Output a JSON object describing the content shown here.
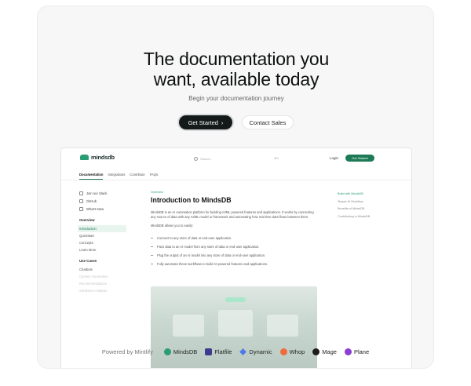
{
  "hero": {
    "title_line1": "The documentation you",
    "title_line2": "want, available today",
    "subtitle": "Begin your documentation journey",
    "primary_button": "Get Started",
    "secondary_button": "Contact Sales"
  },
  "docs": {
    "logo": "mindsdb",
    "search_placeholder": "Search...",
    "search_shortcut": "⌘K",
    "login": "Login",
    "cta": "Get Started",
    "nav_tabs": [
      "Documentation",
      "Integrations",
      "Contribute",
      "FAQs"
    ],
    "sidebar": {
      "links": [
        "Join our Slack",
        "GitHub",
        "What's New"
      ],
      "overview_heading": "Overview",
      "overview_items": [
        "Introduction",
        "Quickstart",
        "Concepts",
        "Learn More"
      ],
      "usecases_heading": "Use Cases",
      "usecases_items": [
        "Chatbots",
        "Content Generation",
        "Recommendations",
        "Sentiment Analysis"
      ]
    },
    "breadcrumb": "Overview",
    "heading": "Introduction to MindsDB",
    "para1": "MindsDB is an AI Automation platform for building AI/ML powered features and applications. It works by connecting any source of data with any AI/ML model or framework and automating how real-time data flows between them.",
    "para2": "MindsDB allows you to easily:",
    "bullets": [
      "Connect to any store of data or end-user application.",
      "Pass data to an AI model from any store of data or end-user application.",
      "Plug the output of an AI model into any store of data or end-user application.",
      "Fully automate these workflows to build AI-powered features and applications."
    ],
    "toc": [
      "Build with MindsDB",
      "Simple AI Workflow",
      "Benefits of MindsDB",
      "Contributing to MindsDB"
    ]
  },
  "powered": {
    "label": "Powered by Mintlify",
    "brands": [
      {
        "name": "MindsDB",
        "color": "#2a9d75"
      },
      {
        "name": "Flatfile",
        "color": "#3b3b8f"
      },
      {
        "name": "Dynamic",
        "color": "#4e7be8"
      },
      {
        "name": "Whop",
        "color": "#f06a3a"
      },
      {
        "name": "Mage",
        "color": "#1d1d1d"
      },
      {
        "name": "Plane",
        "color": "#8a3fd1"
      }
    ]
  }
}
